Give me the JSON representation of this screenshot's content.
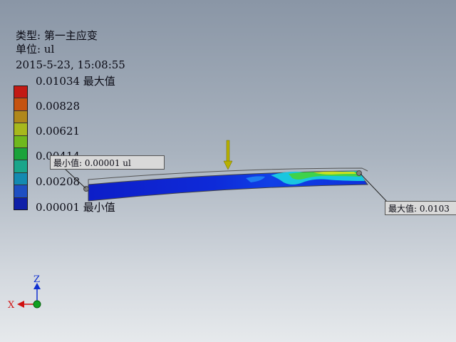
{
  "result_info": {
    "type_label": "类型: 第一主应变",
    "unit_label": "单位: ul",
    "timestamp": "2015-5-23, 15:08:55"
  },
  "legend": {
    "labels": [
      "0.01034 最大值",
      "0.00828",
      "0.00621",
      "0.00414",
      "0.00208",
      "0.00001 最小值"
    ],
    "colors": [
      "#c21a14",
      "#c5530f",
      "#b0871a",
      "#a7b81c",
      "#6fb81c",
      "#1aa33a",
      "#1aa58a",
      "#148ab0",
      "#1f4fc2",
      "#0f1fa8"
    ]
  },
  "callouts": {
    "min": "最小值: 0.00001 ul",
    "max": "最大值: 0.0103"
  },
  "triad": {
    "x": "X",
    "z": "Z",
    "colors": {
      "x": "#d01010",
      "z": "#1030d0",
      "origin": "#10a020"
    }
  },
  "load_arrow_color": "#b8b000"
}
